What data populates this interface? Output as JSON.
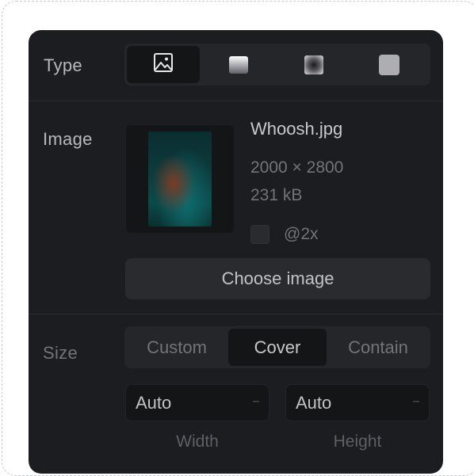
{
  "type_row": {
    "label": "Type",
    "options": [
      {
        "name": "image",
        "icon": "image-icon",
        "active": true
      },
      {
        "name": "linear",
        "icon": "linear-gradient-icon",
        "active": false
      },
      {
        "name": "radial",
        "icon": "radial-gradient-icon",
        "active": false
      },
      {
        "name": "solid",
        "icon": "solid-fill-icon",
        "active": false
      }
    ]
  },
  "image_row": {
    "label": "Image",
    "file_name": "Whoosh.jpg",
    "dimensions": "2000 × 2800",
    "file_size": "231 kB",
    "retina_label": "@2x",
    "retina_checked": false,
    "choose_label": "Choose image"
  },
  "size_row": {
    "label": "Size",
    "options": [
      "Custom",
      "Cover",
      "Contain"
    ],
    "selected": "Cover",
    "width_value": "Auto",
    "height_value": "Auto",
    "width_label": "Width",
    "height_label": "Height"
  },
  "colors": {
    "panel_bg": "#1c1d20",
    "control_bg": "#252629",
    "active_bg": "#141517",
    "text_primary": "#c9c9cc",
    "text_muted": "#737378"
  }
}
